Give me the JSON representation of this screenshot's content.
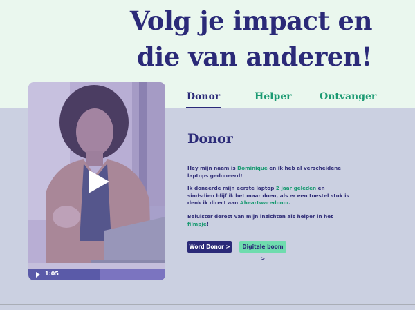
{
  "headline": "Volg je impact en die van anderen!",
  "tabs": [
    {
      "label": "Donor",
      "active": true
    },
    {
      "label": "Helper",
      "active": false
    },
    {
      "label": "Ontvanger",
      "active": false
    }
  ],
  "video": {
    "time": "1:05",
    "progress": 0.52
  },
  "section": {
    "title": "Donor",
    "p1_a": "Hey mijn naam is ",
    "p1_name": "Dominique",
    "p1_b": " en ik heb al verscheidene laptops gedoneerd!",
    "p2_a": "Ik doneerde mijn eerste laptop ",
    "p2_hl": "2 jaar geleden",
    "p2_b": " en sindsdien blijf ik het maar doen, als er een toestel stuk is denk ik direct aan ",
    "p2_tag": "#heartwaredonor",
    "p2_c": ".",
    "p3_a": "Beluister derest van mijn inzichten als helper in het ",
    "p3_link": "filmpje",
    "p3_b": "!"
  },
  "buttons": {
    "word_donor": "Word Donor  >",
    "digitale_boom": "Digitale boom  >"
  },
  "colors": {
    "navy": "#2b2a78",
    "green": "#1b9a72",
    "mint": "#6fdcae",
    "top_bg": "#eaf7ee",
    "bottom_bg": "#cbd0e1"
  }
}
